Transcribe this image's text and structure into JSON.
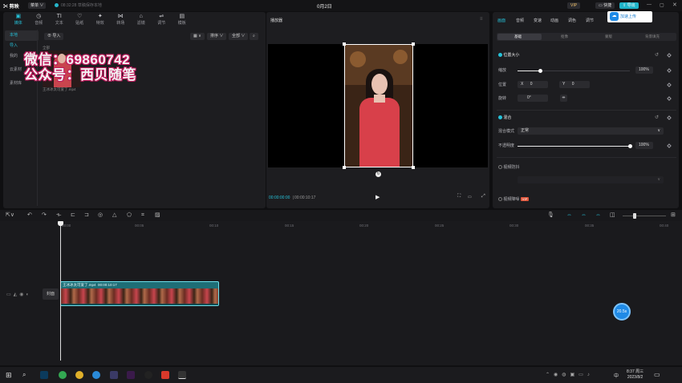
{
  "app": {
    "logo": "✂ 剪映",
    "menu": "菜单 ∨",
    "save_status": "08:32:28 草稿保存本地",
    "project_title": "0月2日",
    "vip": "VIP",
    "shortcut": "快捷",
    "export": "导出"
  },
  "media_tabs": [
    {
      "icon": "▣",
      "label": "媒体"
    },
    {
      "icon": "◷",
      "label": "音频"
    },
    {
      "icon": "TI",
      "label": "文本"
    },
    {
      "icon": "♡",
      "label": "贴纸"
    },
    {
      "icon": "✦",
      "label": "特效"
    },
    {
      "icon": "⋈",
      "label": "转场"
    },
    {
      "icon": "⌂",
      "label": "滤镜"
    },
    {
      "icon": "⇌",
      "label": "调节"
    },
    {
      "icon": "▤",
      "label": "模板"
    }
  ],
  "media_side": [
    "本地",
    "导入",
    "我的",
    "云素材",
    "素材库"
  ],
  "media_area": {
    "import_label": "导入",
    "sort_label": "排序",
    "filter_label": "全部",
    "section_label": "全部",
    "file_name": "王冰冰太可爱了.mp4"
  },
  "watermark": {
    "line1": "微信：69860742",
    "line2": "公众号：西贝随笔"
  },
  "player": {
    "title": "播放器",
    "current_time": "00:00:00:00",
    "total_time": "00:00:10:17"
  },
  "right_panel": {
    "tabs": [
      "画面",
      "音频",
      "变速",
      "动画",
      "调色",
      "调节"
    ],
    "upload_label": "加速上传",
    "subtabs": [
      "基础",
      "抠像",
      "蒙版",
      "背景填充"
    ],
    "position_size": "位置大小",
    "scale_label": "缩放",
    "scale_value": "100%",
    "scale_fraction": 0.2,
    "position_label": "位置",
    "pos_x_label": "X",
    "pos_x": "0",
    "pos_y_label": "Y",
    "pos_y": "0",
    "rotate_label": "旋转",
    "rotate_value": "0°",
    "blend_label": "混合",
    "blend_mode_label": "混合模式",
    "blend_mode_value": "正常",
    "opacity_label": "不透明度",
    "opacity_value": "100%",
    "opacity_fraction": 1.0,
    "stabilize_label": "视频防抖",
    "enhance_label": "视频降噪",
    "enhance_badge": "VIP"
  },
  "timeline": {
    "ruler": [
      "00:00",
      "00:05",
      "00:10",
      "00:15",
      "00:20",
      "00:25",
      "00:30",
      "00:35",
      "00:40"
    ],
    "cover_label": "封面",
    "clip_name": "王冰冰太可爱了.mp4",
    "clip_duration": "00:00:10:17",
    "badge": "20.5s"
  },
  "taskbar": {
    "time": "8:37 周三",
    "date": "2023/8/2",
    "lang": "中"
  },
  "colors": {
    "accent": "#26c2d9",
    "panel": "#1d1d20",
    "clip": "#1e6e76"
  }
}
